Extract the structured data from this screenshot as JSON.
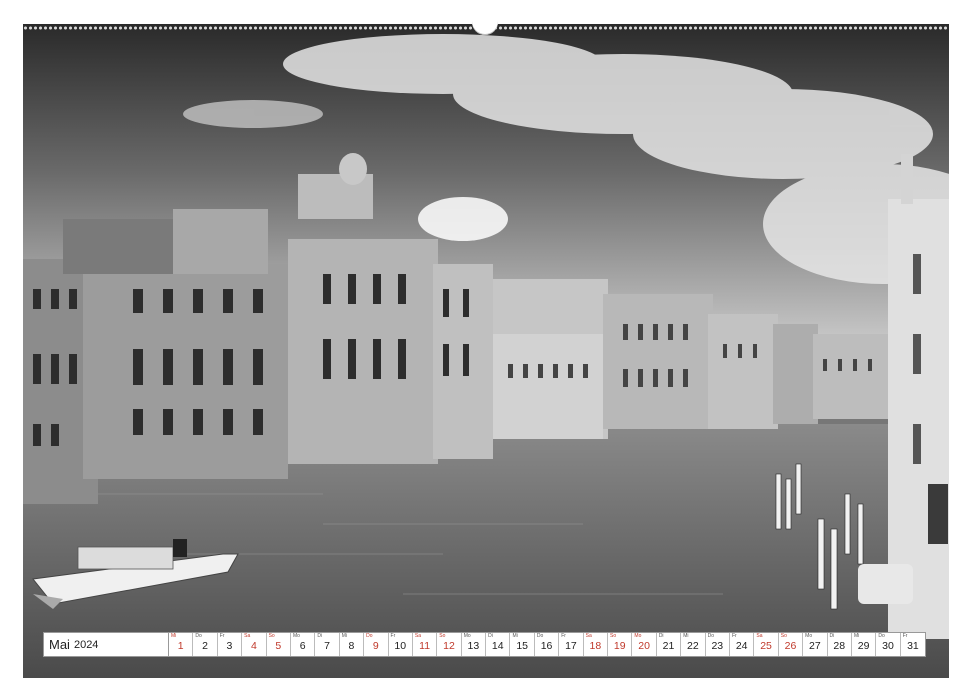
{
  "calendar": {
    "month": "Mai",
    "year": "2024",
    "days": [
      {
        "num": "1",
        "wd": "Mi",
        "red": true
      },
      {
        "num": "2",
        "wd": "Do",
        "red": false
      },
      {
        "num": "3",
        "wd": "Fr",
        "red": false
      },
      {
        "num": "4",
        "wd": "Sa",
        "red": true
      },
      {
        "num": "5",
        "wd": "So",
        "red": true
      },
      {
        "num": "6",
        "wd": "Mo",
        "red": false
      },
      {
        "num": "7",
        "wd": "Di",
        "red": false
      },
      {
        "num": "8",
        "wd": "Mi",
        "red": false
      },
      {
        "num": "9",
        "wd": "Do",
        "red": true
      },
      {
        "num": "10",
        "wd": "Fr",
        "red": false
      },
      {
        "num": "11",
        "wd": "Sa",
        "red": true
      },
      {
        "num": "12",
        "wd": "So",
        "red": true
      },
      {
        "num": "13",
        "wd": "Mo",
        "red": false
      },
      {
        "num": "14",
        "wd": "Di",
        "red": false
      },
      {
        "num": "15",
        "wd": "Mi",
        "red": false
      },
      {
        "num": "16",
        "wd": "Do",
        "red": false
      },
      {
        "num": "17",
        "wd": "Fr",
        "red": false
      },
      {
        "num": "18",
        "wd": "Sa",
        "red": true
      },
      {
        "num": "19",
        "wd": "So",
        "red": true
      },
      {
        "num": "20",
        "wd": "Mo",
        "red": true
      },
      {
        "num": "21",
        "wd": "Di",
        "red": false
      },
      {
        "num": "22",
        "wd": "Mi",
        "red": false
      },
      {
        "num": "23",
        "wd": "Do",
        "red": false
      },
      {
        "num": "24",
        "wd": "Fr",
        "red": false
      },
      {
        "num": "25",
        "wd": "Sa",
        "red": true
      },
      {
        "num": "26",
        "wd": "So",
        "red": true
      },
      {
        "num": "27",
        "wd": "Mo",
        "red": false
      },
      {
        "num": "28",
        "wd": "Di",
        "red": false
      },
      {
        "num": "29",
        "wd": "Mi",
        "red": false
      },
      {
        "num": "30",
        "wd": "Do",
        "red": false
      },
      {
        "num": "31",
        "wd": "Fr",
        "red": false
      }
    ]
  },
  "colors": {
    "holiday_red": "#c0392b",
    "photo_style": "black-and-white"
  },
  "photo": {
    "subject": "canal-with-palazzi-and-motorboat"
  }
}
